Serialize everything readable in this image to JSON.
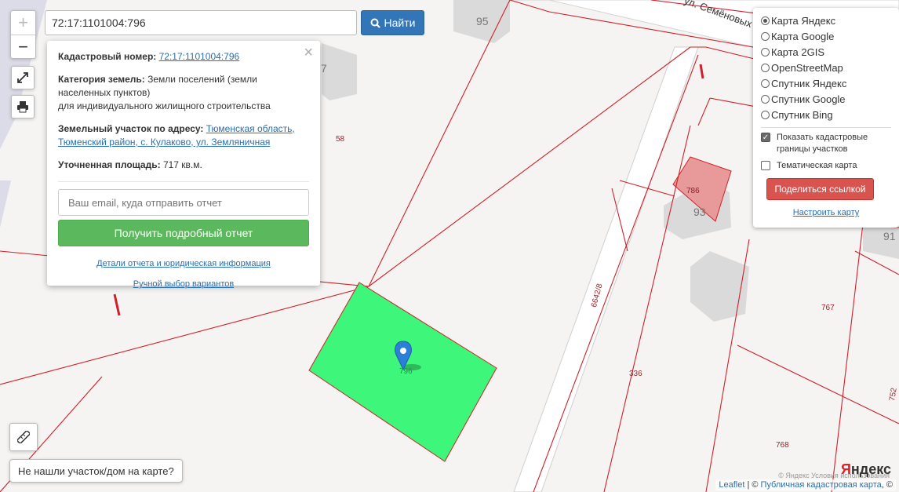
{
  "map": {
    "parcel_labels": [
      "58",
      "6642/8",
      "336",
      "767",
      "768",
      "796",
      "786",
      "752"
    ],
    "street_name": "ул. Семёновых",
    "building_numbers": [
      "95",
      "93",
      "91",
      "7"
    ],
    "selected_parcel_color": "#3ef77a",
    "boundary_color": "#d0202a"
  },
  "controls": {
    "zoom_in": "+",
    "zoom_out": "−",
    "fullscreen_icon": "expand-icon",
    "print_icon": "printer-icon",
    "ruler_icon": "ruler-icon"
  },
  "search": {
    "value": "72:17:1101004:796",
    "button_label": "Найти",
    "button_icon": "search-icon"
  },
  "popup": {
    "cadastral_label": "Кадастровый номер:",
    "cadastral_value": "72:17:1101004:796",
    "category_label": "Категория земель:",
    "category_value": "Земли поселений (земли населенных пунктов)",
    "category_extra": "для индивидуального жилищного строительства",
    "address_label": "Земельный участок по адресу:",
    "address_value": "Тюменская область, Тюменский район, с. Кулаково, ул. Земляничная",
    "area_label": "Уточненная площадь:",
    "area_value": "717 кв.м.",
    "email_placeholder": "Ваш email, куда отправить отчет",
    "report_button": "Получить подробный отчет",
    "details_link": "Детали отчета и юридическая информация",
    "manual_link": "Ручной выбор вариантов",
    "close": "×"
  },
  "layers": {
    "options": [
      {
        "label": "Карта Яндекс",
        "selected": true
      },
      {
        "label": "Карта Google",
        "selected": false
      },
      {
        "label": "Карта 2GIS",
        "selected": false
      },
      {
        "label": "OpenStreetMap",
        "selected": false
      },
      {
        "label": "Спутник Яндекс",
        "selected": false
      },
      {
        "label": "Спутник Google",
        "selected": false
      },
      {
        "label": "Спутник Bing",
        "selected": false
      }
    ],
    "show_cadastral": "Показать кадастровые границы участков",
    "show_cadastral_checked": true,
    "thematic": "Тематическая карта",
    "thematic_checked": false,
    "share_button": "Поделиться ссылкой",
    "setup_link": "Настроить карту"
  },
  "bottom": {
    "not_found": "Не нашли участок/дом на карте?",
    "attribution_leaflet": "Leaflet",
    "attribution_sep": " | © ",
    "attribution_pkk": "Публичная кадастровая карта",
    "attribution_tail": ", ©",
    "yandex_logo_y": "Я",
    "yandex_logo_rest": "ндекс",
    "copyright": "© Яндекс Условия использования"
  }
}
